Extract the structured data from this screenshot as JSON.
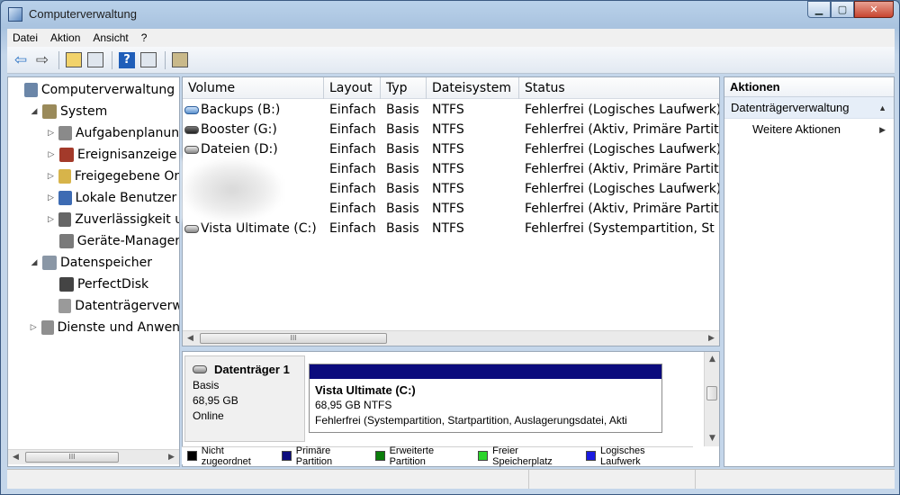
{
  "window": {
    "title": "Computerverwaltung"
  },
  "menu": [
    "Datei",
    "Aktion",
    "Ansicht",
    "?"
  ],
  "tree": [
    {
      "label": "Computerverwaltung (L",
      "level": 0,
      "toggle": "",
      "icon": "computer-management-icon",
      "color": "#6b86a8"
    },
    {
      "label": "System",
      "level": 1,
      "toggle": "◢",
      "icon": "tools-icon",
      "color": "#9a8a5a"
    },
    {
      "label": "Aufgabenplanung",
      "level": 2,
      "toggle": "▷",
      "icon": "clock-icon",
      "color": "#8a8a8a"
    },
    {
      "label": "Ereignisanzeige",
      "level": 2,
      "toggle": "▷",
      "icon": "event-viewer-icon",
      "color": "#a33a2a"
    },
    {
      "label": "Freigegebene Ordr",
      "level": 2,
      "toggle": "▷",
      "icon": "shared-folder-icon",
      "color": "#d7b44a"
    },
    {
      "label": "Lokale Benutzer u",
      "level": 2,
      "toggle": "▷",
      "icon": "users-icon",
      "color": "#3d6bb3"
    },
    {
      "label": "Zuverlässigkeit un",
      "level": 2,
      "toggle": "▷",
      "icon": "reliability-icon",
      "color": "#666666"
    },
    {
      "label": "Geräte-Manager",
      "level": 2,
      "toggle": "",
      "icon": "device-manager-icon",
      "color": "#7a7a7a"
    },
    {
      "label": "Datenspeicher",
      "level": 1,
      "toggle": "◢",
      "icon": "storage-icon",
      "color": "#8a97a6"
    },
    {
      "label": "PerfectDisk",
      "level": 2,
      "toggle": "",
      "icon": "perfectdisk-icon",
      "color": "#444444"
    },
    {
      "label": "Datenträgerverwa",
      "level": 2,
      "toggle": "",
      "icon": "disk-management-icon",
      "color": "#9a9a9a"
    },
    {
      "label": "Dienste und Anwendu",
      "level": 1,
      "toggle": "▷",
      "icon": "services-icon",
      "color": "#8f8f8f"
    }
  ],
  "columns": [
    "Volume",
    "Layout",
    "Typ",
    "Dateisystem",
    "Status"
  ],
  "volumes": [
    {
      "volume": "Backups (B:)",
      "layout": "Einfach",
      "typ": "Basis",
      "fs": "NTFS",
      "status": "Fehlerfrei (Logisches Laufwerk)",
      "icon": "blue"
    },
    {
      "volume": "Booster (G:)",
      "layout": "Einfach",
      "typ": "Basis",
      "fs": "NTFS",
      "status": "Fehlerfrei (Aktiv, Primäre Partit",
      "icon": "dark"
    },
    {
      "volume": "Dateien (D:)",
      "layout": "Einfach",
      "typ": "Basis",
      "fs": "NTFS",
      "status": "Fehlerfrei (Logisches Laufwerk)",
      "icon": "gray"
    },
    {
      "volume": "",
      "layout": "Einfach",
      "typ": "Basis",
      "fs": "NTFS",
      "status": "Fehlerfrei (Aktiv, Primäre Partit",
      "icon": "none"
    },
    {
      "volume": "",
      "layout": "Einfach",
      "typ": "Basis",
      "fs": "NTFS",
      "status": "Fehlerfrei (Logisches Laufwerk)",
      "icon": "none"
    },
    {
      "volume": "",
      "layout": "Einfach",
      "typ": "Basis",
      "fs": "NTFS",
      "status": "Fehlerfrei (Aktiv, Primäre Partit",
      "icon": "none"
    },
    {
      "volume": "Vista Ultimate (C:)",
      "layout": "Einfach",
      "typ": "Basis",
      "fs": "NTFS",
      "status": "Fehlerfrei (Systempartition, St",
      "icon": "gray"
    }
  ],
  "disk": {
    "name": "Datenträger 1",
    "type": "Basis",
    "size": "68,95 GB",
    "state": "Online",
    "partition": {
      "name": "Vista Ultimate  (C:)",
      "size": "68,95 GB NTFS",
      "status": "Fehlerfrei (Systempartition, Startpartition, Auslagerungsdatei, Akti"
    }
  },
  "legend": [
    {
      "label": "Nicht zugeordnet",
      "color": "#000000"
    },
    {
      "label": "Primäre Partition",
      "color": "#0b0b7d"
    },
    {
      "label": "Erweiterte Partition",
      "color": "#0a7d0a"
    },
    {
      "label": "Freier Speicherplatz",
      "color": "#2bd42b"
    },
    {
      "label": "Logisches Laufwerk",
      "color": "#1a1ae0"
    }
  ],
  "actions": {
    "title": "Aktionen",
    "group": "Datenträgerverwaltung",
    "items": [
      "Weitere Aktionen"
    ]
  },
  "scroll": {
    "thumb_glyph": "III"
  }
}
